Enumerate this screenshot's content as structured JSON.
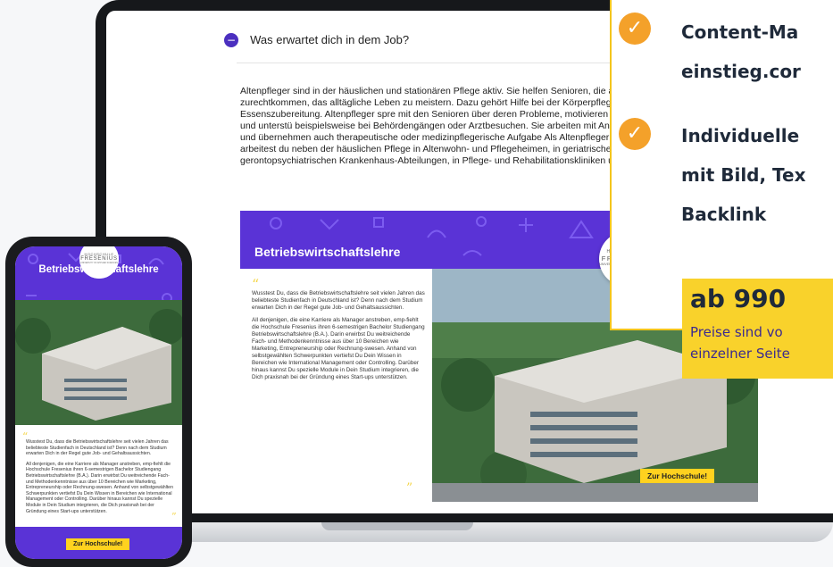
{
  "laptop": {
    "faq_question": "Was erwartet dich in dem Job?",
    "faq_answer": "Altenpfleger sind in der häuslichen und stationären Pflege aktiv. Sie helfen Senioren, die allein nicht mehr zurechtkommen, das alltägliche Leben zu meistern. Dazu gehört Hilfe bei der Körperpflege, dem Anziehen, der Essenszubereitung. Altenpfleger spre mit den Senioren über deren Probleme, motivieren sie zu mehr Aktivität und unterstü beispielsweise bei Behördengängen oder Arztbesuchen. Sie arbeiten mit Angehörige zusammen und übernehmen auch therapeutische oder medizinpflegerische Aufgabe Als Altenpfleger oder Altenpflegerin arbeitest du neben der häuslichen Pflege in Altenwohn- und Pflegeheimen, in geriatrischen oder gerontopsychiatrischen Krankenhaus-Abteilungen, in Pflege- und Rehabilitationskliniken und in Hospizen.",
    "article": {
      "title": "Betriebswirtschaftslehre",
      "logo_top": "HOCHSCHULE",
      "logo_main": "FRESENIUS",
      "logo_sub": "UNIVERSITY OF APPLIED SCIENCES",
      "paragraph1": "Wusstest Du, dass die Betriebswirtschaftslehre seit vielen Jahren das beliebteste Studienfach in Deutschland ist? Denn nach dem Studium erwarten Dich in der Regel gute Job- und Gehaltsaussichten.",
      "paragraph2": "All denjenigen, die eine Karriere als Manager anstreben, emp-fiehlt die Hochschule Fresenius ihren 6-semestrigen Bachelor Studiengang Betriebswirtschaftslehre (B.A.). Darin erwirbst Du weitreichende Fach- und Methodenkenntnisse aus über 10 Bereichen wie Marketing, Entrepreneurship oder Rechnung-swesen. Anhand von selbstgewählten Schwerpunkten vertiefst Du Dein Wissen in Bereichen wie International Management oder Controlling. Darüber hinaus kannst Du spezielle Module in Dein Studium integrieren, die Dich praxisnah bei der Gründung eines Start-ups unterstützen.",
      "button": "Zur Hochschule!"
    }
  },
  "features": [
    {
      "lines": [
        "Content-Ma",
        "einstieg.cor"
      ],
      "icon": "check-circle-icon"
    },
    {
      "lines": [
        "Individuelle",
        "mit Bild, Tex",
        "Backlink"
      ],
      "icon": "check-circle-icon"
    }
  ],
  "price": {
    "value": "ab 990",
    "note_line1": "Preise sind vo",
    "note_line2": "einzelner Seite"
  },
  "phone": {
    "title": "Betriebswirtschaftslehre",
    "logo_top": "HOCHSCHULE",
    "logo_main": "FRESENIUS",
    "logo_sub": "UNIVERSITY OF APPLIED SCIENCES",
    "paragraph1": "Wusstest Du, dass die Betriebswirtschaftslehre seit vielen Jahren das beliebteste Studienfach in Deutschland ist? Denn nach dem Studium erwarten Dich in der Regel gute Job- und Gehaltsaussichten.",
    "paragraph2": "All denjenigen, die eine Karriere als Manager anstreben, emp-fiehlt die Hochschule Fresenius ihren 6-semestrigen Bachelor Studiengang Betriebswirtschaftslehre (B.A.). Darin erwirbst Du weitreichende Fach- und Methodenkenntnisse aus über 10 Bereichen wie Marketing, Entrepreneurship oder Rechnung-swesen. Anhand von selbstgewählten Schwerpunkten vertiefst Du Dein Wissen in Bereichen wie International Management oder Controlling. Darüber hinaus kannst Du spezielle Module in Dein Studium integrieren, die Dich praxisnah bei der Gründung eines Start-ups unterstützen.",
    "button": "Zur Hochschule!"
  },
  "colors": {
    "purple": "#5a33d6",
    "yellow": "#f9d22b",
    "orange_check": "#f4a12a",
    "navy_text": "#1f2a3a"
  }
}
